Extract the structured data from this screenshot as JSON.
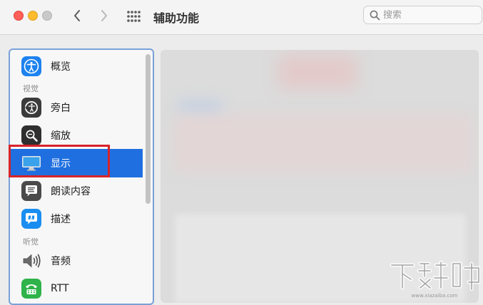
{
  "window": {
    "title": "辅助功能"
  },
  "search": {
    "placeholder": "搜索"
  },
  "sidebar": {
    "items": [
      {
        "label": "概览",
        "icon": "accessibility-icon",
        "color": "#1d82ef"
      },
      {
        "section": "视觉"
      },
      {
        "label": "旁白",
        "icon": "voiceover-icon",
        "color": "#3b3b3b"
      },
      {
        "label": "缩放",
        "icon": "zoom-icon",
        "color": "#2f2f2f"
      },
      {
        "label": "显示",
        "icon": "display-icon",
        "color": "#2a9ee8",
        "selected": true
      },
      {
        "label": "朗读内容",
        "icon": "speech-bubble-icon",
        "color": "#4a4a4a"
      },
      {
        "label": "描述",
        "icon": "description-icon",
        "color": "#1a8ef0"
      },
      {
        "section": "听觉"
      },
      {
        "label": "音频",
        "icon": "speaker-icon",
        "color": "#ffffff"
      },
      {
        "label": "RTT",
        "icon": "rtt-icon",
        "color": "#2fb34a"
      }
    ]
  },
  "colors": {
    "accent": "#1f6fe0",
    "highlight": "#d8232a"
  },
  "watermark": {
    "text": "下载吧",
    "subtext": "www.xiazaiba.com"
  }
}
